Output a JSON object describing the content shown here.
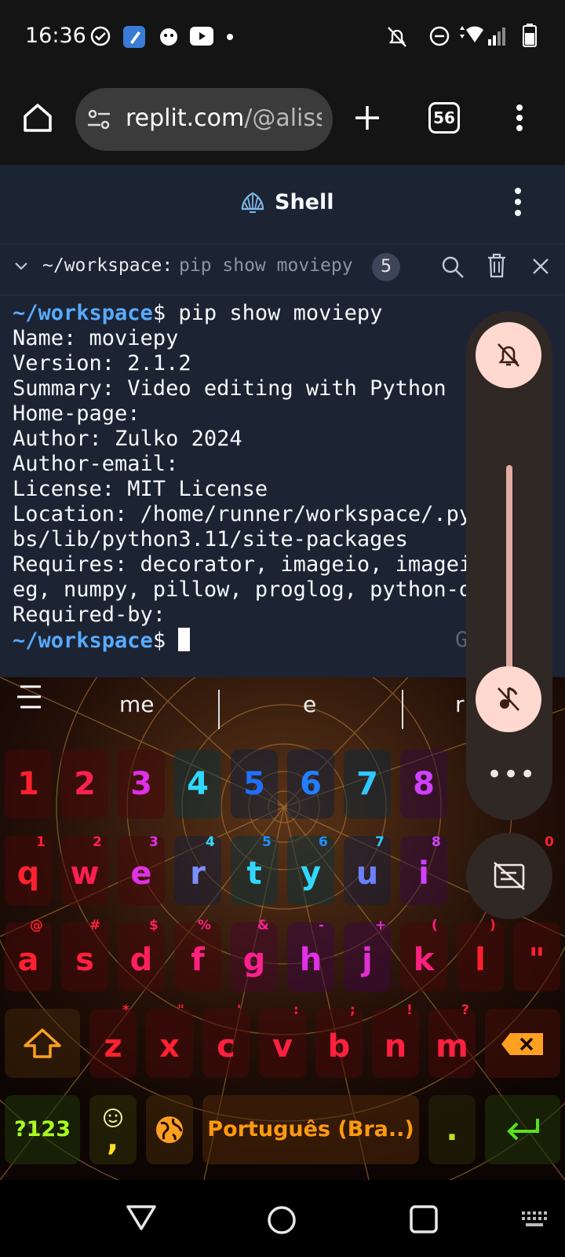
{
  "status_bar": {
    "time": "16:36",
    "icons": [
      "check-circle-icon",
      "app-icon",
      "app-icon-2",
      "youtube-icon",
      "dot-icon",
      "bell-off-icon",
      "dnd-icon",
      "wifi-icon",
      "signal-icon",
      "battery-icon"
    ]
  },
  "browser": {
    "url_host": "replit.com",
    "url_path": "/@aliss",
    "tab_count": "56"
  },
  "replit": {
    "title": "Shell",
    "tab_path": "~/workspace:",
    "tab_command": "pip show moviepy",
    "tab_badge": "5"
  },
  "terminal": {
    "prompt_path": "~/workspace",
    "prompt_symbol": "$",
    "command": " pip show moviepy",
    "output": [
      "Name: moviepy",
      "Version: 2.1.2",
      "Summary: Video editing with Python",
      "Home-page:",
      "Author: Zulko 2024",
      "Author-email:",
      "License: MIT License",
      "Location: /home/runner/workspace/.py",
      "bs/lib/python3.11/site-packages",
      "Requires: decorator, imageio, imagei",
      "eg, numpy, pillow, proglog, python-d",
      "Required-by:"
    ],
    "second_prompt_path": "~/workspace",
    "second_prompt_symbol": "$",
    "right_hint": "G"
  },
  "keyboard": {
    "suggestions": [
      "me",
      "e",
      "r"
    ],
    "number_row": [
      "1",
      "2",
      "3",
      "4",
      "5",
      "6",
      "7",
      "8"
    ],
    "row1": [
      "q",
      "w",
      "e",
      "r",
      "t",
      "y",
      "u",
      "i"
    ],
    "row1_hints": [
      "1",
      "2",
      "3",
      "4",
      "5",
      "6",
      "7",
      "8",
      "0"
    ],
    "row2": [
      "a",
      "s",
      "d",
      "f",
      "g",
      "h",
      "j",
      "k",
      "l",
      "\""
    ],
    "row2_hints": [
      "@",
      "#",
      "$",
      "%",
      "&",
      "-",
      "+",
      "(",
      ")"
    ],
    "row3": [
      "z",
      "x",
      "c",
      "v",
      "b",
      "n",
      "m"
    ],
    "row3_hints": [
      "*",
      "\"",
      "'",
      ":",
      ";",
      "!",
      "?"
    ],
    "symbols_key": "?123",
    "comma_key": ",",
    "space_label": "Português (Bra..)",
    "period_key": "."
  },
  "volume_panel": {
    "more_label": "•••"
  },
  "colors": {
    "terminal_bg": "#1c2333",
    "prompt": "#57abff",
    "rainbow": [
      "#ff2030",
      "#ff2090",
      "#e040ff",
      "#30d0ff",
      "#2090ff",
      "#2070ff",
      "#30c0ff",
      "#c040ff"
    ]
  }
}
